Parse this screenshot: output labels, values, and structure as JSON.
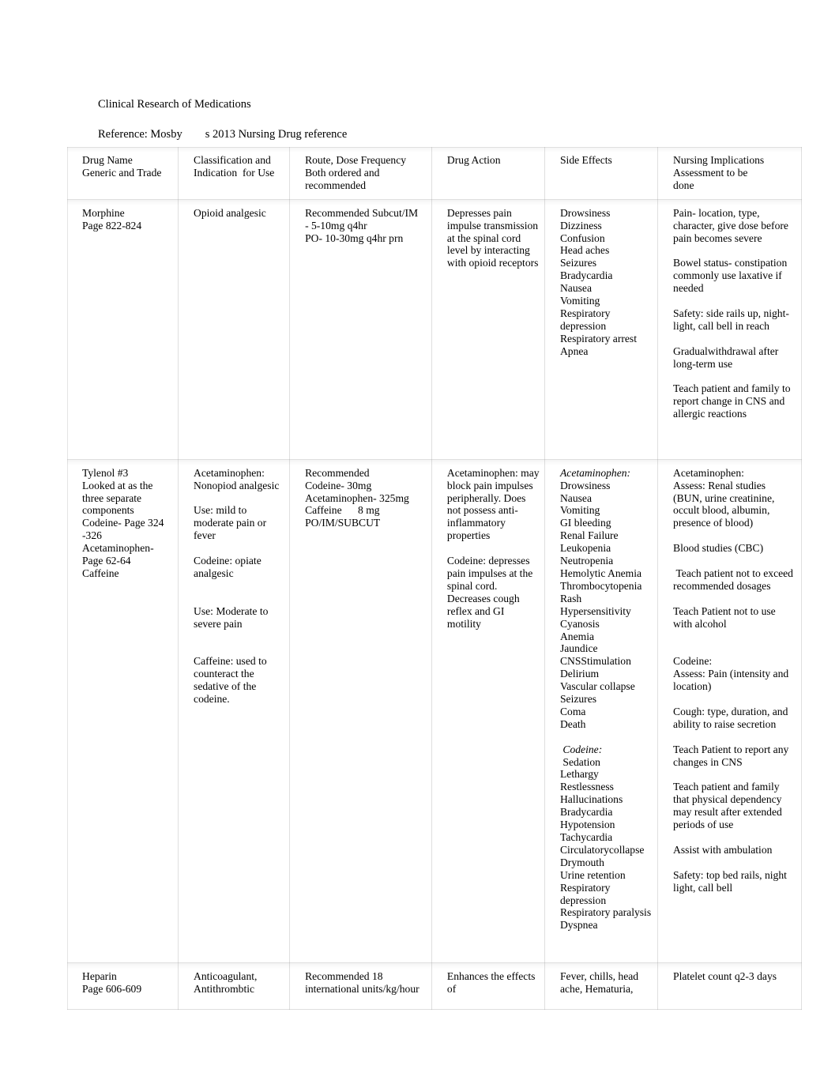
{
  "document": {
    "title": "Clinical Research of Medications",
    "reference": "Reference: Mosby        s 2013 Nursing Drug reference"
  },
  "table": {
    "headers": [
      "Drug Name\nGeneric and Trade",
      "Classification and\nIndication  for Use",
      "Route, Dose Frequency\nBoth ordered and\nrecommended",
      "Drug Action",
      "Side Effects",
      "Nursing Implications\nAssessment to be\ndone"
    ],
    "rows": [
      {
        "name": "morphine",
        "drug_name": "Morphine\nPage 822-824",
        "classification": "Opioid analgesic",
        "route_dose": "Recommended Subcut/IM\n- 5-10mg q4hr\nPO- 10-30mg q4hr prn",
        "drug_action": "Depresses pain impulse transmission at the spinal cord level by interacting with opioid receptors",
        "side_effects": "Drowsiness\nDizziness\nConfusion\nHead aches\nSeizures\nBradycardia\nNausea\nVomiting\nRespiratory depression\nRespiratory arrest\nApnea",
        "nursing_implications": "Pain- location, type, character, give dose before pain becomes severe\n\nBowel status- constipation commonly use laxative if needed\n\nSafety: side rails up, night- light, call bell in reach\n\nGradualwithdrawal after long-term use\n\nTeach patient and family to report change in CNS and allergic reactions"
      },
      {
        "name": "tylenol-3",
        "drug_name": "Tylenol #3\nLooked at as the three separate components\nCodeine- Page 324 -326\nAcetaminophen- Page 62-64\nCaffeine",
        "classification": "Acetaminophen: Nonopiod analgesic\n\nUse: mild to moderate pain or fever\n\nCodeine: opiate analgesic\n\n\nUse: Moderate to severe pain\n\n\nCaffeine: used to counteract the sedative of the codeine.",
        "route_dose": "Recommended\nCodeine- 30mg\nAcetaminophen- 325mg\nCaffeine      8 mg\nPO/IM/SUBCUT",
        "drug_action": "Acetaminophen: may block pain impulses peripherally. Does not possess anti-inflammatory properties\n\nCodeine: depresses pain impulses at the spinal cord. Decreases cough reflex and GI motility",
        "side_effects_italic_1": "Acetaminophen:",
        "side_effects_part_1": "Drowsiness\nNausea\nVomiting\nGI bleeding\nRenal Failure\nLeukopenia\nNeutropenia\nHemolytic Anemia\nThrombocytopenia\nRash\nHypersensitivity\nCyanosis\nAnemia\nJaundice\nCNSStimulation\nDelirium\nVascular collapse\nSeizures\nComa\nDeath",
        "side_effects_italic_2": " Codeine:",
        "side_effects_part_2": " Sedation\nLethargy\nRestlessness\nHallucinations\nBradycardia\nHypotension\nTachycardia\nCirculatorycollapse\nDrymouth\nUrine retention\nRespiratory depression\nRespiratory paralysis\nDyspnea",
        "nursing_implications": "Acetaminophen:\nAssess: Renal studies (BUN, urine creatinine, occult blood, albumin, presence of blood)\n\nBlood studies (CBC)\n\n Teach patient not to exceed recommended dosages\n\nTeach Patient not to use with alcohol\n\n\nCodeine:\nAssess: Pain (intensity and location)\n\nCough: type, duration, and ability to raise secretion\n\nTeach Patient to report any changes in CNS\n\nTeach patient and family that physical dependency may result after extended periods of use\n\nAssist with ambulation\n\nSafety: top bed rails, night light, call bell"
      },
      {
        "name": "heparin",
        "drug_name": "Heparin\nPage 606-609",
        "classification": "Anticoagulant, Antithrombtic",
        "route_dose": "Recommended 18 international units/kg/hour",
        "drug_action": "Enhances the effects of",
        "side_effects": "Fever, chills, head ache, Hematuria,",
        "nursing_implications": "Platelet count q2-3 days"
      }
    ]
  }
}
